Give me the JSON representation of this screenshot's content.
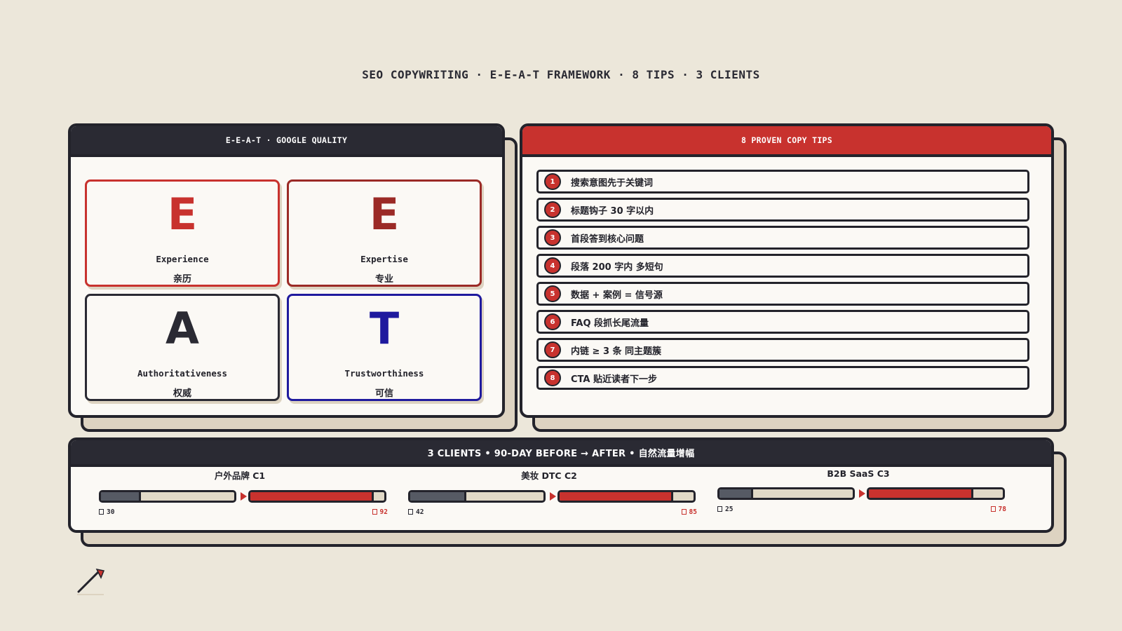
{
  "title": "SEO COPYWRITING · E-E-A-T FRAMEWORK · 8 TIPS · 3 CLIENTS",
  "colors": {
    "background": "#ece7da",
    "ink": "#23232b",
    "red": "#c8322e",
    "dark_red": "#9b2a26",
    "navy": "#1f1a9e",
    "panel": "#fbf9f5",
    "shadow": "#ddd3c1"
  },
  "eeat": {
    "header": "E-E-A-T · GOOGLE QUALITY",
    "cards": [
      {
        "letter": "E",
        "en": "Experience",
        "zh": "亲历",
        "color": "#c8322e"
      },
      {
        "letter": "E",
        "en": "Expertise",
        "zh": "专业",
        "color": "#9b2a26"
      },
      {
        "letter": "A",
        "en": "Authoritativeness",
        "zh": "权威",
        "color": "#2a2a33"
      },
      {
        "letter": "T",
        "en": "Trustworthiness",
        "zh": "可信",
        "color": "#1f1a9e"
      }
    ]
  },
  "tips": {
    "header": "8 PROVEN COPY TIPS",
    "items": [
      {
        "num": "1",
        "text": "搜索意图先于关键词"
      },
      {
        "num": "2",
        "text": "标题钩子 30 字以内"
      },
      {
        "num": "3",
        "text": "首段答到核心问题"
      },
      {
        "num": "4",
        "text": "段落 200 字内 多短句"
      },
      {
        "num": "5",
        "text": "数据 + 案例 = 信号源"
      },
      {
        "num": "6",
        "text": "FAQ 段抓长尾流量"
      },
      {
        "num": "7",
        "text": "内链 ≥ 3 条 同主题簇"
      },
      {
        "num": "8",
        "text": "CTA 贴近读者下一步"
      }
    ]
  },
  "clients": {
    "header": "3 CLIENTS • 90-DAY BEFORE → AFTER • 自然流量增幅",
    "items": [
      {
        "name": "户外品牌 C1",
        "before": 30,
        "after": 92,
        "before_label": "30",
        "after_label": "92"
      },
      {
        "name": "美妆 DTC C2",
        "before": 42,
        "after": 85,
        "before_label": "42",
        "after_label": "85"
      },
      {
        "name": "B2B SaaS C3",
        "before": 25,
        "after": 78,
        "before_label": "25",
        "after_label": "78"
      }
    ]
  }
}
